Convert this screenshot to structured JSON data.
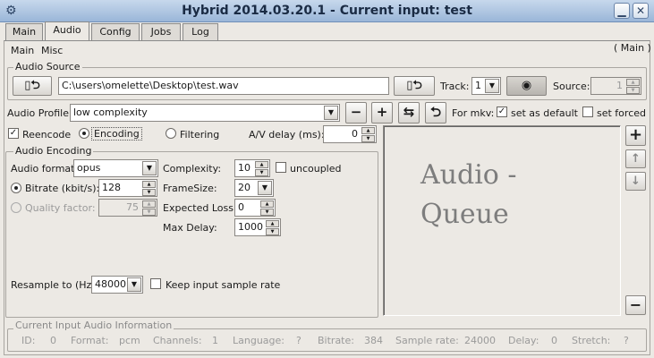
{
  "window": {
    "title": "Hybrid 2014.03.20.1 - Current input: test",
    "menu_icon": "gear-icon",
    "minimize_icon": "minimize-icon",
    "close_icon": "close-icon",
    "minimize_glyph": "▁",
    "close_glyph": "✕"
  },
  "tabs": [
    "Main",
    "Audio",
    "Config",
    "Jobs",
    "Log"
  ],
  "active_tab": "Audio",
  "subtabs": [
    "Main",
    "Misc"
  ],
  "context_label": "( Main )",
  "audio_source": {
    "title": "Audio Source",
    "path": "C:\\users\\omelette\\Desktop\\test.wav",
    "track_label": "Track:",
    "track_value": "1",
    "source_label": "Source:",
    "source_value": "1"
  },
  "audio_profile": {
    "label": "Audio Profile:",
    "value": "low complexity",
    "for_mkv_label": "For mkv:",
    "set_default_label": "set as default",
    "set_default_checked": true,
    "set_forced_label": "set forced",
    "set_forced_checked": false
  },
  "mode": {
    "reencode_label": "Reencode",
    "reencode_checked": true,
    "encoding_label": "Encoding",
    "filtering_label": "Filtering",
    "selected": "Encoding",
    "av_delay_label": "A/V delay (ms):",
    "av_delay_value": "0"
  },
  "audio_encoding": {
    "title": "Audio Encoding",
    "format_label": "Audio format:",
    "format_value": "opus",
    "bitrate_label": "Bitrate (kbit/s):",
    "bitrate_value": "128",
    "quality_label": "Quality factor:",
    "quality_value": "75",
    "rate_mode": "Bitrate",
    "complexity_label": "Complexity:",
    "complexity_value": "10",
    "uncoupled_label": "uncoupled",
    "uncoupled_checked": false,
    "framesize_label": "FrameSize:",
    "framesize_value": "20",
    "expected_loss_label": "Expected Loss:",
    "expected_loss_value": "0",
    "max_delay_label": "Max Delay:",
    "max_delay_value": "1000",
    "resample_label": "Resample to (Hz):",
    "resample_value": "48000",
    "keep_rate_label": "Keep input sample rate",
    "keep_rate_checked": false
  },
  "queue": {
    "placeholder_line1": "Audio -",
    "placeholder_line2": "Queue",
    "add_glyph": "+",
    "up_glyph": "↑",
    "down_glyph": "↓",
    "remove_glyph": "−"
  },
  "info": {
    "title": "Current Input Audio Information",
    "fields": [
      {
        "label": "ID:",
        "value": "0"
      },
      {
        "label": "Format:",
        "value": "pcm"
      },
      {
        "label": "Channels:",
        "value": "1"
      },
      {
        "label": "Language:",
        "value": "?"
      },
      {
        "label": "Bitrate:",
        "value": "384"
      },
      {
        "label": "Sample rate:",
        "value": "24000"
      },
      {
        "label": "Delay:",
        "value": "0"
      },
      {
        "label": "Stretch:",
        "value": "?"
      }
    ]
  },
  "glyphs": {
    "check": "✓",
    "combo_arrow": "▼",
    "spin_up": "▲",
    "spin_down": "▼",
    "undo": "⮌",
    "plus": "+",
    "minus": "−",
    "swap": "⇆",
    "eye": "◉",
    "film": "▯"
  },
  "colors": {
    "window_bg": "#ece9e4",
    "titlebar": "#9ab6d8",
    "queue_text": "#7d7d7d"
  }
}
